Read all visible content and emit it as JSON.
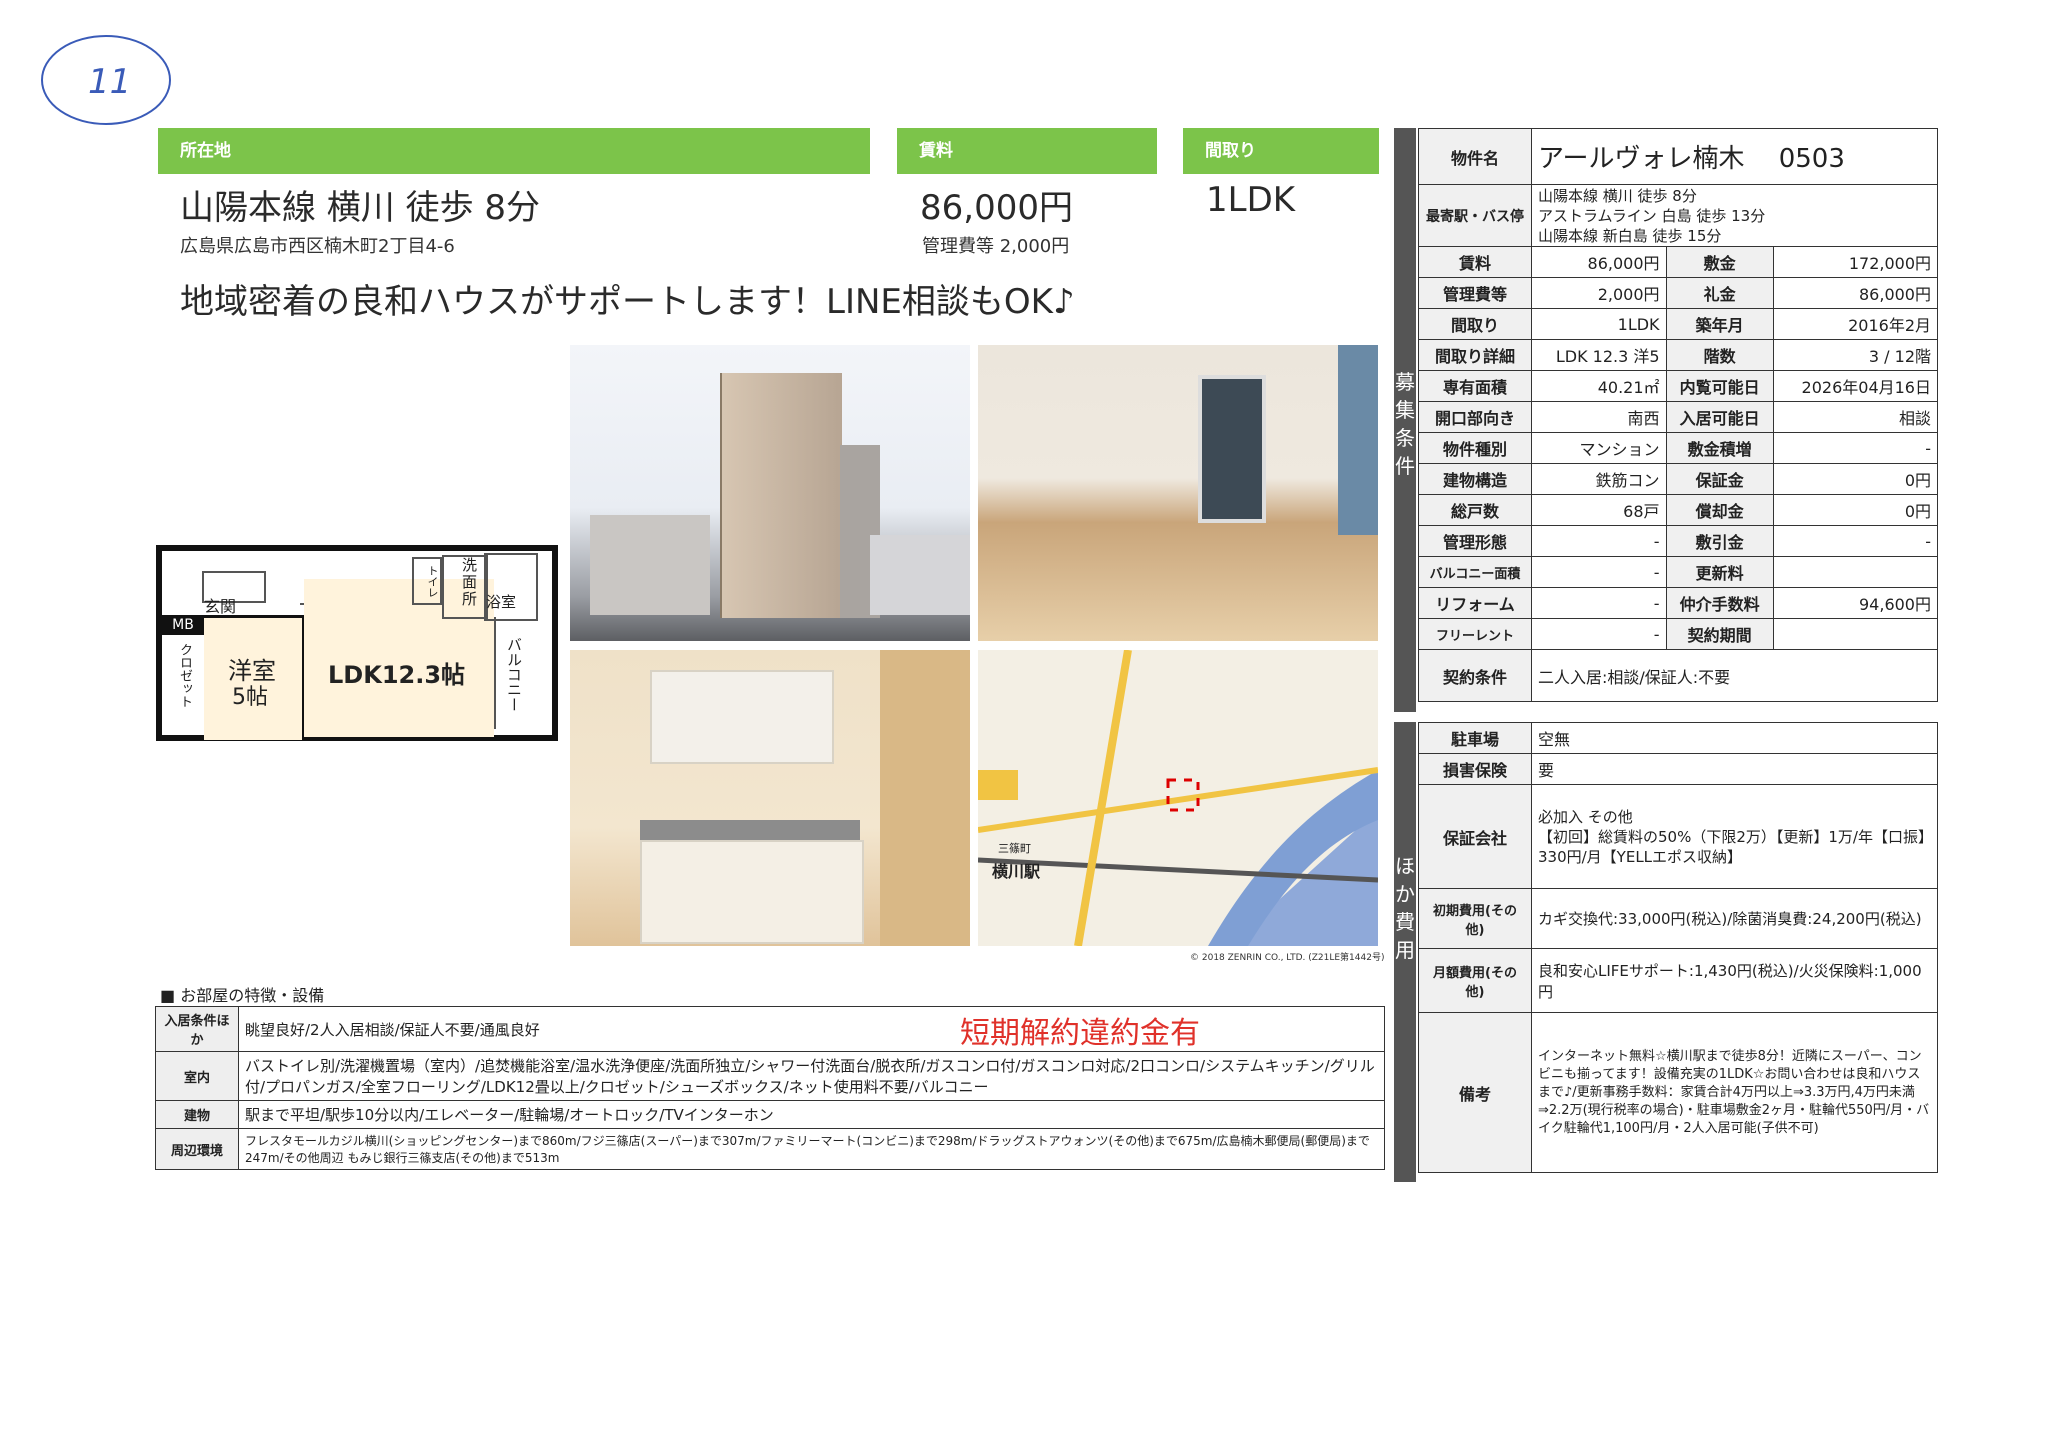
{
  "handwritten_number": "11",
  "header": {
    "location_label": "所在地",
    "rent_label": "賃料",
    "layout_label": "間取り",
    "station_access": "山陽本線 横川 徒歩 8分",
    "address": "広島県広島市西区楠木町2丁目4-6",
    "rent": "86,000円",
    "management_fee": "管理費等 2,000円",
    "layout": "1LDK",
    "tagline": "地域密着の良和ハウスがサポートします！LINE相談もOK♪"
  },
  "floorplan": {
    "room1": "洋室",
    "room1_size": "5帖",
    "room2": "LDK12.3帖",
    "entrance": "玄関",
    "wash": "洗面所",
    "bath": "浴室",
    "toilet": "トイレ",
    "closet": "クロゼット",
    "mb": "MB",
    "balcony": "バルコニー"
  },
  "map_caption": "© 2018 ZENRIN CO., LTD. (Z21LE第1442号)",
  "map_labels": {
    "station": "横川駅",
    "area": "三篠町"
  },
  "sidebar": {
    "recruit": "募集条件",
    "other": "ほか費用"
  },
  "spec": {
    "property_name_label": "物件名",
    "property_name": "アールヴォレ楠木　 0503",
    "nearest_label": "最寄駅・バス停",
    "nearest": [
      "山陽本線 横川 徒歩 8分",
      "アストラムライン 白島 徒歩 13分",
      "山陽本線 新白島 徒歩 15分"
    ],
    "rows": [
      [
        "賃料",
        "86,000円",
        "敷金",
        "172,000円"
      ],
      [
        "管理費等",
        "2,000円",
        "礼金",
        "86,000円"
      ],
      [
        "間取り",
        "1LDK",
        "築年月",
        "2016年2月"
      ],
      [
        "間取り詳細",
        "LDK 12.3 洋5",
        "階数",
        "3 / 12階"
      ],
      [
        "専有面積",
        "40.21㎡",
        "内覧可能日",
        "2026年04月16日"
      ],
      [
        "開口部向き",
        "南西",
        "入居可能日",
        "相談"
      ],
      [
        "物件種別",
        "マンション",
        "敷金積増",
        "-"
      ],
      [
        "建物構造",
        "鉄筋コン",
        "保証金",
        "0円"
      ],
      [
        "総戸数",
        "68戸",
        "償却金",
        "0円"
      ],
      [
        "管理形態",
        "-",
        "敷引金",
        "-"
      ],
      [
        "バルコニー面積",
        "-",
        "更新料",
        ""
      ],
      [
        "リフォーム",
        "-",
        "仲介手数料",
        "94,600円"
      ],
      [
        "フリーレント",
        "-",
        "契約期間",
        ""
      ]
    ],
    "contract_label": "契約条件",
    "contract": "二人入居:相談/保証人:不要",
    "parking_label": "駐車場",
    "parking": "空無",
    "insurance_label": "損害保険",
    "insurance": "要",
    "guarantor_label": "保証会社",
    "guarantor": "必加入 その他\n【初回】総賃料の50%（下限2万）【更新】1万/年【口振】330円/月【YELLエポス収納】",
    "initial_cost_label": "初期費用(その他)",
    "initial_cost": "カギ交換代:33,000円(税込)/除菌消臭費:24,200円(税込)",
    "monthly_cost_label": "月額費用(その他)",
    "monthly_cost": "良和安心LIFEサポート:1,430円(税込)/火災保険料:1,000円",
    "remarks_label": "備考",
    "remarks": "インターネット無料☆横川駅まで徒歩8分！近隣にスーパー、コンビニも揃ってます！設備充実の1LDK☆お問い合わせは良和ハウスまで♪/更新事務手数料：家賃合計4万円以上⇒3.3万円,4万円未満⇒2.2万(現行税率の場合)・駐車場敷金2ヶ月・駐輪代550円/月・バイク駐輪代1,100円/月・2人入居可能(子供不可)"
  },
  "features": {
    "title": "■ お部屋の特徴・設備",
    "stamp": "短期解約違約金有",
    "rows": [
      [
        "入居条件ほか",
        "眺望良好/2人入居相談/保証人不要/通風良好"
      ],
      [
        "室内",
        "バストイレ別/洗濯機置場（室内）/追焚機能浴室/温水洗浄便座/洗面所独立/シャワー付洗面台/脱衣所/ガスコンロ付/ガスコンロ対応/2口コンロ/システムキッチン/グリル付/プロパンガス/全室フローリング/LDK12畳以上/クロゼット/シューズボックス/ネット使用料不要/バルコニー"
      ],
      [
        "建物",
        "駅まで平坦/駅歩10分以内/エレベーター/駐輪場/オートロック/TVインターホン"
      ],
      [
        "周辺環境",
        "フレスタモールカジル横川(ショッピングセンター)まで860m/フジ三篠店(スーパー)まで307m/ファミリーマート(コンビニ)まで298m/ドラッグストアウォンツ(その他)まで675m/広島楠木郵便局(郵便局)まで247m/その他周辺 もみじ銀行三篠支店(その他)まで513m"
      ]
    ]
  }
}
